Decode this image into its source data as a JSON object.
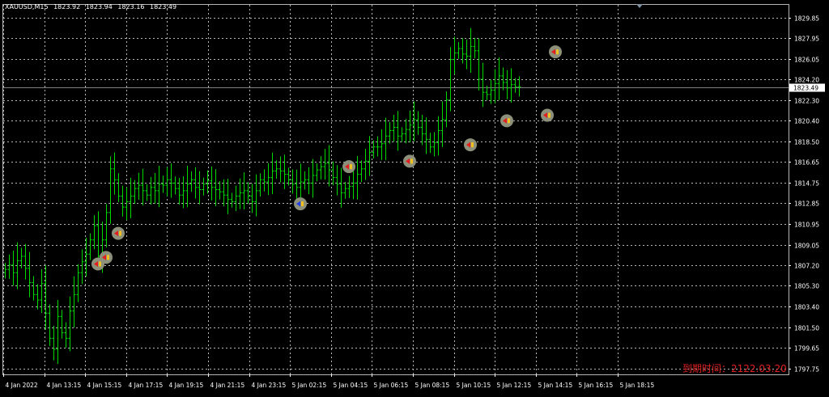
{
  "window": {
    "symbol": "XAUUSD,M15",
    "ohlc": [
      "1823.92",
      "1823.94",
      "1823.16",
      "1823.49"
    ]
  },
  "expiry_text": "到期时间：2122.03.20",
  "colors": {
    "background": "#000000",
    "grid": "#b4b4b4",
    "candle": "#00d800",
    "axis_text": "#ffffff",
    "bid_line": "#7f7f7f",
    "expiry_text": "#e02020",
    "marker_fill": "#8c907a",
    "sell_arrow": "#e41d1d",
    "buy_arrow": "#2540e0",
    "shift_marker": "#8090a0"
  },
  "chart_data": {
    "type": "candlestick",
    "symbol": "XAUUSD",
    "timeframe": "M15",
    "current_price": "1823.49",
    "y_axis": {
      "range": [
        1797.2,
        1831.0
      ],
      "tick_labels": [
        "1829.85",
        "1827.95",
        "1826.05",
        "1824.20",
        "1822.30",
        "1820.40",
        "1818.50",
        "1816.65",
        "1814.75",
        "1812.85",
        "1810.95",
        "1809.05",
        "1807.20",
        "1805.30",
        "1803.40",
        "1801.50",
        "1799.65",
        "1797.75"
      ]
    },
    "x_axis": {
      "tick_labels": [
        "4 Jan 2022",
        "4 Jan 13:15",
        "4 Jan 15:15",
        "4 Jan 17:15",
        "4 Jan 19:15",
        "4 Jan 21:15",
        "4 Jan 23:15",
        "5 Jan 02:15",
        "5 Jan 04:15",
        "5 Jan 06:15",
        "5 Jan 08:15",
        "5 Jan 10:15",
        "5 Jan 12:15",
        "5 Jan 14:15",
        "5 Jan 16:15",
        "5 Jan 18:15"
      ]
    },
    "grid": true,
    "closes": [
      1806.8,
      1807.2,
      1806.5,
      1807.6,
      1808.0,
      1806.9,
      1805.6,
      1804.5,
      1804.0,
      1805.5,
      1802.8,
      1800.5,
      1799.5,
      1802.5,
      1801.0,
      1800.5,
      1803.0,
      1804.5,
      1806.5,
      1807.5,
      1808.2,
      1809.5,
      1810.8,
      1808.0,
      1809.5,
      1812.0,
      1816.0,
      1815.0,
      1813.5,
      1812.5,
      1813.0,
      1813.5,
      1814.2,
      1814.5,
      1814.0,
      1813.6,
      1814.3,
      1814.0,
      1814.6,
      1814.5,
      1815.0,
      1814.7,
      1814.2,
      1813.6,
      1814.0,
      1814.6,
      1815.0,
      1814.3,
      1814.1,
      1814.6,
      1814.9,
      1814.3,
      1814.1,
      1813.9,
      1813.6,
      1813.2,
      1813.0,
      1813.5,
      1813.8,
      1814.0,
      1813.5,
      1813.0,
      1814.0,
      1815.0,
      1814.8,
      1815.2,
      1815.8,
      1816.0,
      1815.8,
      1815.5,
      1815.0,
      1814.6,
      1814.3,
      1814.8,
      1815.0,
      1814.7,
      1815.4,
      1815.9,
      1816.2,
      1816.5,
      1815.9,
      1815.2,
      1814.6,
      1813.8,
      1814.2,
      1814.4,
      1814.7,
      1815.5,
      1816.0,
      1816.7,
      1817.5,
      1818.0,
      1818.0,
      1818.3,
      1819.0,
      1819.5,
      1819.8,
      1819.0,
      1819.2,
      1819.6,
      1820.0,
      1820.5,
      1819.8,
      1819.2,
      1818.7,
      1818.0,
      1818.4,
      1819.5,
      1820.5,
      1822.3,
      1826.0,
      1826.6,
      1827.0,
      1826.5,
      1826.3,
      1827.2,
      1826.8,
      1824.2,
      1823.0,
      1822.8,
      1823.2,
      1823.8,
      1824.5,
      1823.9,
      1823.4,
      1823.7,
      1823.5,
      1823.49
    ],
    "signals": [
      {
        "time_index": 23,
        "type": "sell",
        "price": 1807.3
      },
      {
        "time_index": 25,
        "type": "sell",
        "price": 1807.9
      },
      {
        "time_index": 28,
        "type": "sell",
        "price": 1810.1
      },
      {
        "time_index": 73,
        "type": "buy",
        "price": 1812.8
      },
      {
        "time_index": 85,
        "type": "sell",
        "price": 1816.2
      },
      {
        "time_index": 100,
        "type": "sell",
        "price": 1816.7
      },
      {
        "time_index": 115,
        "type": "sell",
        "price": 1818.2
      },
      {
        "time_index": 124,
        "type": "sell",
        "price": 1820.4
      },
      {
        "time_index": 134,
        "type": "sell",
        "price": 1820.9
      },
      {
        "time_index": 136,
        "type": "sell",
        "price": 1826.7
      }
    ]
  }
}
